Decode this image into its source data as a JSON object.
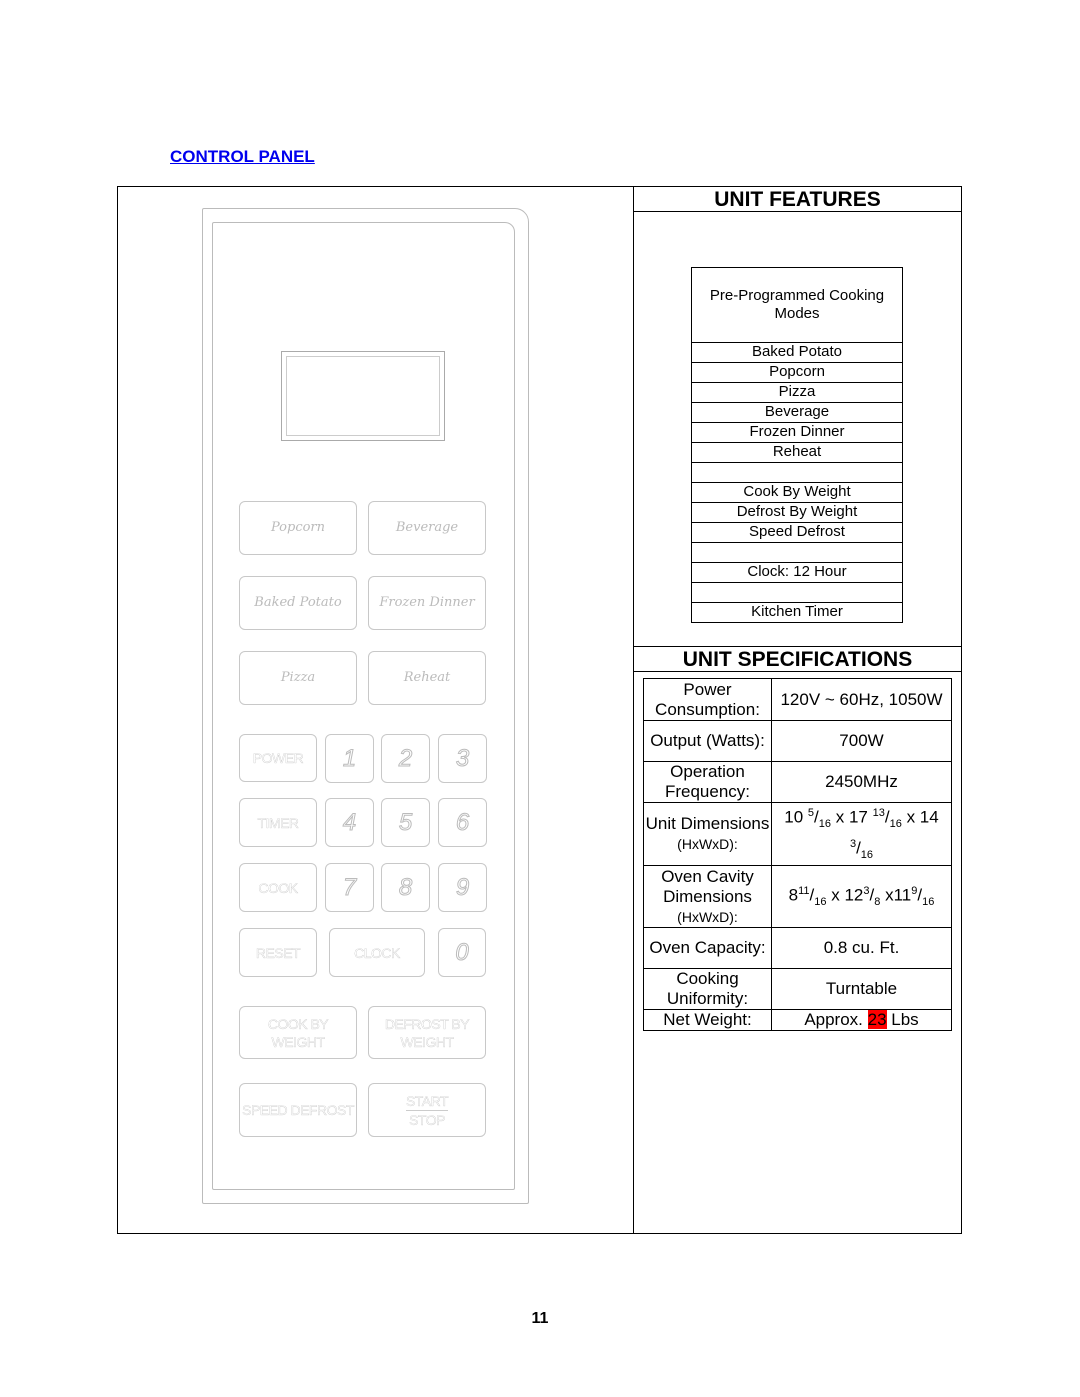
{
  "heading": "CONTROL PANEL",
  "features": {
    "title": "UNIT FEATURES",
    "header": "Pre-Programmed Cooking Modes",
    "rows": [
      "Baked Potato",
      "Popcorn",
      "Pizza",
      "Beverage",
      "Frozen Dinner",
      "Reheat",
      "",
      "Cook By Weight",
      "Defrost By Weight",
      "Speed Defrost",
      "",
      "Clock:  12 Hour",
      "",
      "Kitchen Timer"
    ]
  },
  "specs": {
    "title": "UNIT SPECIFICATIONS",
    "rows": [
      {
        "key": "Power Consumption:",
        "value": [
          {
            "t": "120V ~ 60Hz, 1050W"
          }
        ]
      },
      {
        "key": "Output (Watts):",
        "value": [
          {
            "t": "700W"
          }
        ]
      },
      {
        "key": "Operation Frequency:",
        "value": [
          {
            "t": "2450MHz"
          }
        ]
      },
      {
        "key": "Unit Dimensions",
        "key_small": "(HxWxD):",
        "value": [
          {
            "t": "10 "
          },
          {
            "sup": "5"
          },
          {
            "t": "/"
          },
          {
            "sub": "16"
          },
          {
            "t": " x 17 "
          },
          {
            "sup": "13"
          },
          {
            "t": "/"
          },
          {
            "sub": "16"
          },
          {
            "t": " x 14 "
          },
          {
            "sup": "3"
          },
          {
            "t": "/"
          },
          {
            "sub": "16"
          }
        ]
      },
      {
        "key": "Oven Cavity Dimensions",
        "key_small": "(HxWxD):",
        "value": [
          {
            "t": "8"
          },
          {
            "sup": "11"
          },
          {
            "t": "/"
          },
          {
            "sub": "16"
          },
          {
            "t": " x 12"
          },
          {
            "sup": "3"
          },
          {
            "t": "/"
          },
          {
            "sub": "8"
          },
          {
            "t": " x11"
          },
          {
            "sup": "9"
          },
          {
            "t": "/"
          },
          {
            "sub": "16"
          }
        ]
      },
      {
        "key": "Oven Capacity:",
        "value": [
          {
            "t": "0.8 cu. Ft."
          }
        ]
      },
      {
        "key": "Cooking Uniformity:",
        "value": [
          {
            "t": "Turntable"
          }
        ]
      },
      {
        "key": "Net Weight:",
        "value": [
          {
            "t": "Approx. "
          },
          {
            "hl": "23"
          },
          {
            "t": " Lbs"
          }
        ]
      }
    ]
  },
  "panel": {
    "buttons": {
      "popcorn": "Popcorn",
      "beverage": "Beverage",
      "baked_potato": "Baked Potato",
      "frozen_dinner": "Frozen Dinner",
      "pizza": "Pizza",
      "reheat": "Reheat",
      "power": "POWER",
      "timer": "TIMER",
      "cook": "COOK",
      "reset": "RESET",
      "clock": "CLOCK",
      "cook_by_weight": "COOK BY WEIGHT",
      "defrost_by_weight": "DEFROST BY WEIGHT",
      "speed_defrost": "SPEED DEFROST",
      "start": "START",
      "stop": "STOP"
    },
    "digits": [
      "1",
      "2",
      "3",
      "4",
      "5",
      "6",
      "7",
      "8",
      "9",
      "0"
    ]
  },
  "page_number": "11",
  "colors": {
    "link": "#0000ee",
    "highlight": "#ff0000",
    "panel_line": "#bbbbbb"
  }
}
